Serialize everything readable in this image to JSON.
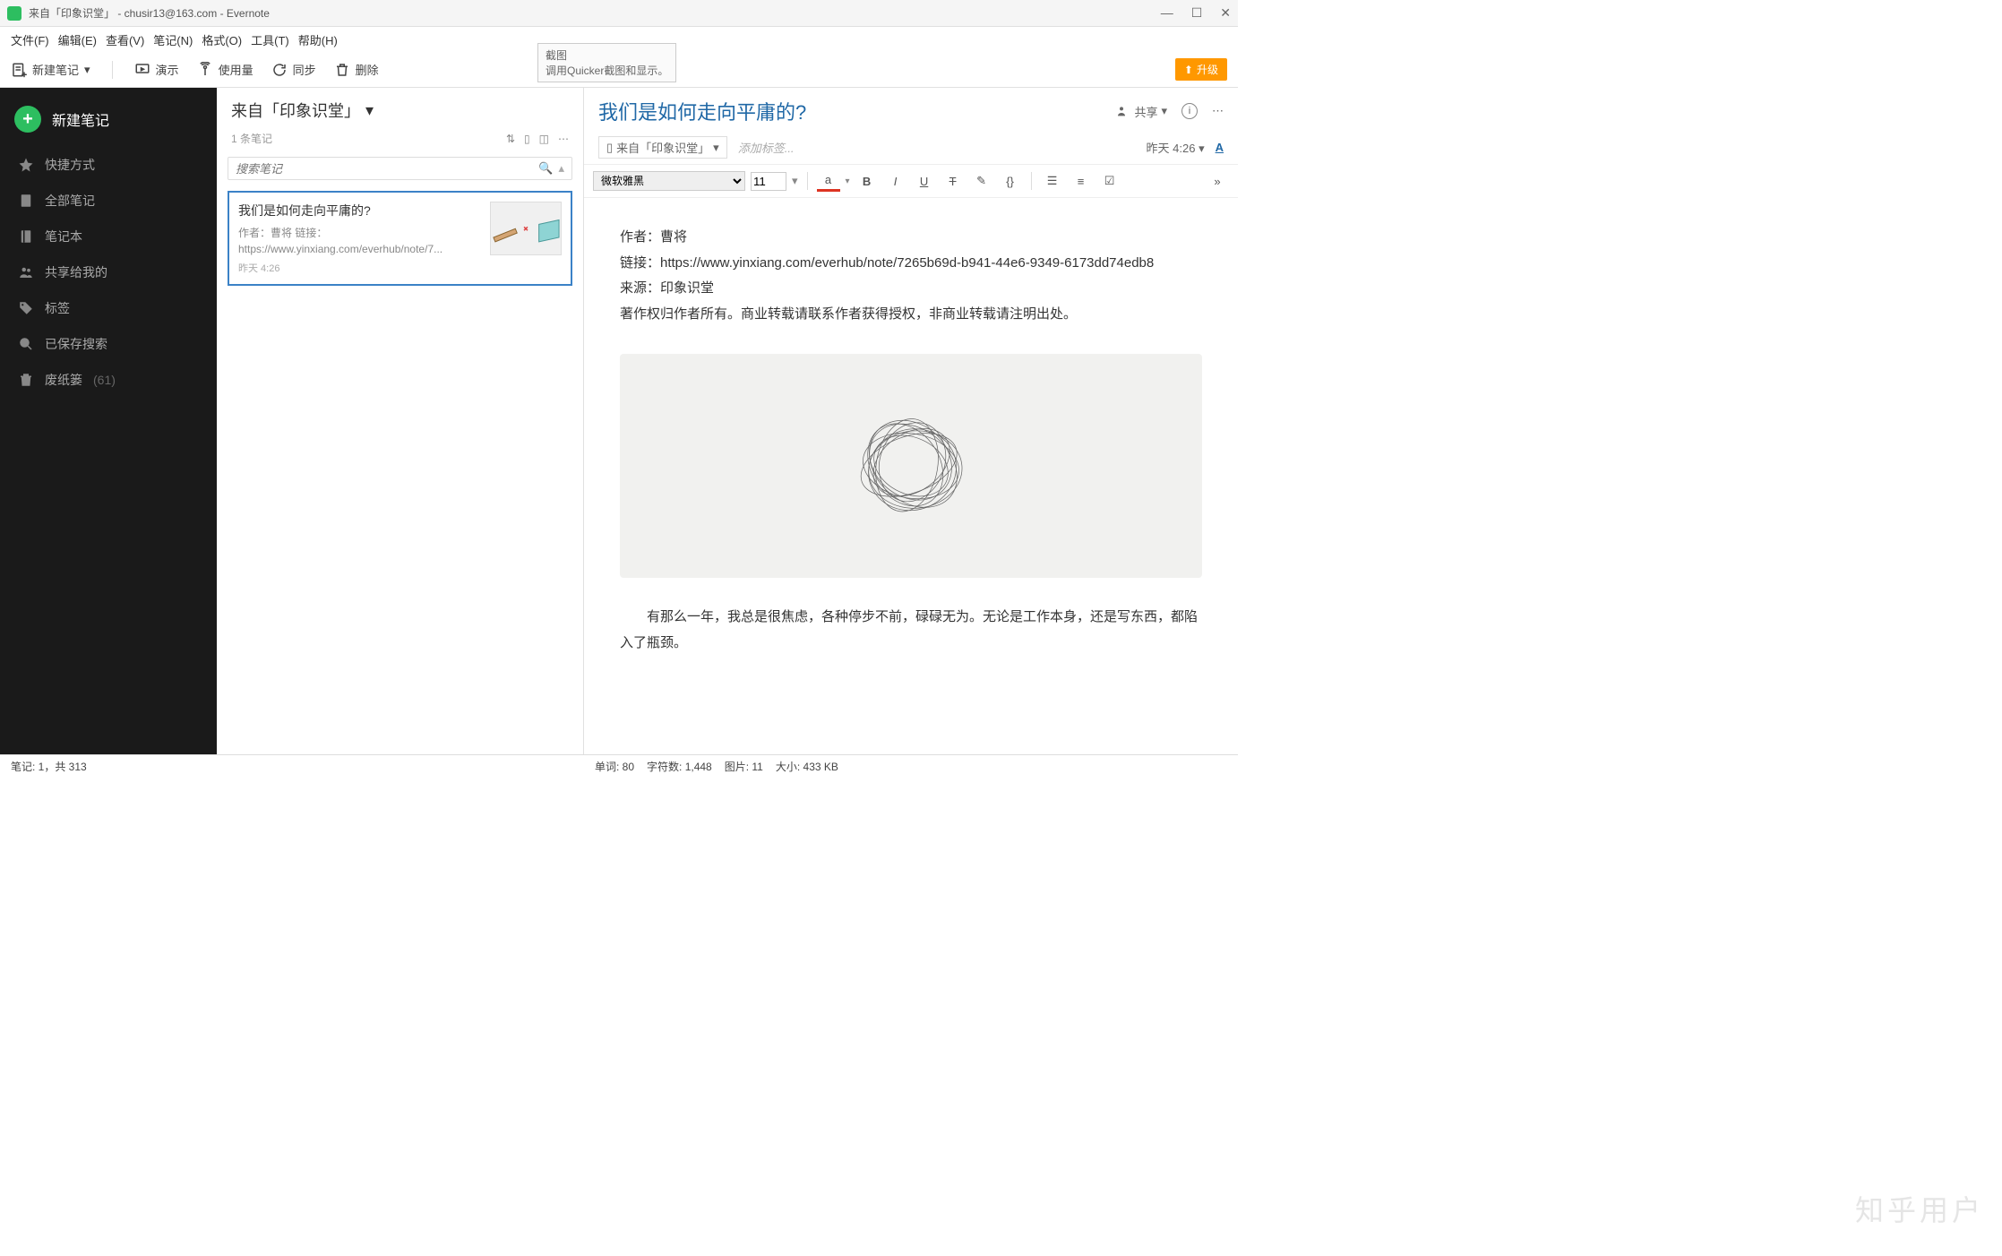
{
  "window": {
    "title": "来自「印象识堂」 - chusir13@163.com - Evernote"
  },
  "menu": {
    "file": "文件(F)",
    "edit": "编辑(E)",
    "view": "查看(V)",
    "note": "笔记(N)",
    "format": "格式(O)",
    "tools": "工具(T)",
    "help": "帮助(H)"
  },
  "toolbar": {
    "new_note": "新建笔记",
    "present": "演示",
    "usage": "使用量",
    "sync": "同步",
    "delete": "删除",
    "upgrade": "升级"
  },
  "tooltip": {
    "title": "截图",
    "body": "调用Quicker截图和显示。"
  },
  "sidebar": {
    "new_note": "新建笔记",
    "shortcuts": "快捷方式",
    "all_notes": "全部笔记",
    "notebooks": "笔记本",
    "shared": "共享给我的",
    "tags": "标签",
    "saved_search": "已保存搜索",
    "trash": "废纸篓",
    "trash_count": "(61)"
  },
  "notelist": {
    "title": "来自「印象识堂」",
    "count": "1 条笔记",
    "search_placeholder": "搜索笔记",
    "card": {
      "title": "我们是如何走向平庸的?",
      "excerpt": "作者：曹将 链接：https://www.yinxiang.com/everhub/note/7...",
      "time": "昨天 4:26"
    }
  },
  "editor": {
    "title": "我们是如何走向平庸的?",
    "share": "共享",
    "notebook": "来自「印象识堂」",
    "add_tag": "添加标签...",
    "timestamp": "昨天 4:26",
    "font": "微软雅黑",
    "size": "11",
    "body": {
      "l1": "作者：曹将",
      "l2": "链接：https://www.yinxiang.com/everhub/note/7265b69d-b941-44e6-9349-6173dd74edb8",
      "l3": "来源：印象识堂",
      "l4": "著作权归作者所有。商业转载请联系作者获得授权，非商业转载请注明出处。",
      "l5": "有那么一年，我总是很焦虑，各种停步不前，碌碌无为。无论是工作本身，还是写东西，都陷入了瓶颈。"
    }
  },
  "status": {
    "notes": "笔记:  1，共 313",
    "words": "单词:  80",
    "chars": "字符数:  1,448",
    "images": "图片:  11",
    "size": "大小:  433 KB"
  },
  "watermark": "知乎用户"
}
